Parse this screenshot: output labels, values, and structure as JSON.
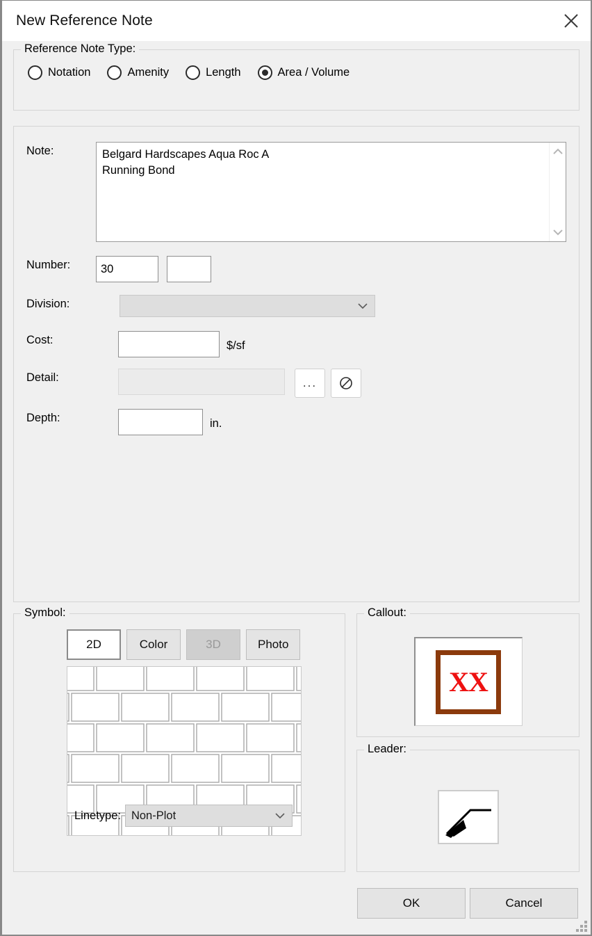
{
  "window": {
    "title": "New Reference Note",
    "close_icon": "close-icon"
  },
  "type_group": {
    "legend": "Reference Note Type:",
    "options": [
      {
        "label": "Notation",
        "selected": false
      },
      {
        "label": "Amenity",
        "selected": false
      },
      {
        "label": "Length",
        "selected": false
      },
      {
        "label": "Area / Volume",
        "selected": true
      }
    ]
  },
  "fields": {
    "note": {
      "label": "Note:",
      "value": "Belgard Hardscapes Aqua Roc A\nRunning Bond",
      "scroll_up_icon": "chevron-up-icon",
      "scroll_down_icon": "chevron-down-icon"
    },
    "number": {
      "label": "Number:",
      "value": "30",
      "suffix_value": ""
    },
    "division": {
      "label": "Division:",
      "value": "",
      "enabled": false,
      "chevron_icon": "chevron-down-icon"
    },
    "cost": {
      "label": "Cost:",
      "value": "",
      "unit": "$/sf"
    },
    "detail": {
      "label": "Detail:",
      "value": "",
      "browse_label": "...",
      "browse_icon": "ellipsis-icon",
      "clear_icon": "no-entry-icon"
    },
    "depth": {
      "label": "Depth:",
      "value": "",
      "unit": "in."
    }
  },
  "symbol": {
    "legend": "Symbol:",
    "tabs": [
      {
        "label": "2D",
        "state": "active"
      },
      {
        "label": "Color",
        "state": "normal"
      },
      {
        "label": "3D",
        "state": "disabled"
      },
      {
        "label": "Photo",
        "state": "normal"
      }
    ],
    "preview_name": "running-bond-brick-pattern",
    "linetype": {
      "label": "Linetype:",
      "value": "Non-Plot",
      "chevron_icon": "chevron-down-icon"
    }
  },
  "callout": {
    "legend": "Callout:",
    "text": "XX",
    "border_color": "#8b3a0c",
    "text_color": "#ee1111"
  },
  "leader": {
    "legend": "Leader:",
    "preview_name": "leader-arrow-icon"
  },
  "footer": {
    "ok_label": "OK",
    "cancel_label": "Cancel",
    "grip_icon": "resize-grip-icon"
  }
}
